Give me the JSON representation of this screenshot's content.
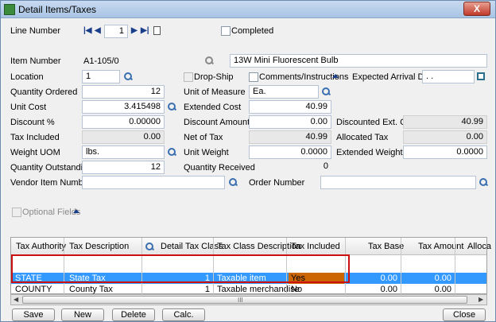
{
  "window": {
    "title": "Detail Items/Taxes",
    "close_label": "X"
  },
  "record": {
    "line_label": "Line Number",
    "line_value": "1",
    "completed_label": "Completed"
  },
  "item": {
    "label": "Item Number",
    "value": "A1-105/0",
    "description": "13W Mini Fluorescent Bulb"
  },
  "fields": {
    "location_label": "Location",
    "location_value": "1",
    "dropship_label": "Drop-Ship",
    "comments_label": "Comments/Instructions",
    "arrival_label": "Expected Arrival Date",
    "arrival_value": "  .  .",
    "qty_ordered_label": "Quantity Ordered",
    "qty_ordered_value": "12",
    "uom_label": "Unit of Measure",
    "uom_value": "Ea.",
    "unit_cost_label": "Unit Cost",
    "unit_cost_value": "3.415498",
    "ext_cost_label": "Extended Cost",
    "ext_cost_value": "40.99",
    "discount_pct_label": "Discount %",
    "discount_pct_value": "0.00000",
    "discount_amt_label": "Discount Amount",
    "discount_amt_value": "0.00",
    "disc_ext_cost_label": "Discounted Ext. Cost",
    "disc_ext_cost_value": "40.99",
    "tax_included_label": "Tax Included",
    "tax_included_value": "0.00",
    "net_of_tax_label": "Net of Tax",
    "net_of_tax_value": "40.99",
    "allocated_tax_label": "Allocated Tax",
    "allocated_tax_value": "0.00",
    "weight_uom_label": "Weight UOM",
    "weight_uom_value": "lbs.",
    "unit_weight_label": "Unit Weight",
    "unit_weight_value": "0.0000",
    "ext_weight_label": "Extended Weight",
    "ext_weight_value": "0.0000",
    "qty_outstanding_label": "Quantity Outstanding",
    "qty_outstanding_value": "12",
    "qty_received_label": "Quantity Received",
    "qty_received_value": "0",
    "vendor_item_label": "Vendor Item Number",
    "vendor_item_value": "",
    "order_number_label": "Order Number",
    "order_number_value": "",
    "optional_fields_label": "Optional Fields"
  },
  "grid": {
    "columns": [
      "Tax Authority",
      "Tax Description",
      "Detail Tax Class",
      "Tax Class Description",
      "Tax Included",
      "Tax Base",
      "Tax Amount",
      "Alloca"
    ],
    "rows": [
      [
        "STATE",
        "State Tax",
        "1",
        "Taxable item",
        "Yes",
        "0.00",
        "0.00"
      ],
      [
        "COUNTY",
        "County Tax",
        "1",
        "Taxable merchandise",
        "No",
        "0.00",
        "0.00"
      ]
    ],
    "scroll_grip": "III"
  },
  "buttons": {
    "save": "Save",
    "new": "New",
    "delete": "Delete",
    "calc_taxes": "Calc. Taxes",
    "close": "Close"
  },
  "colors": {
    "selection": "#3399ff",
    "highlight_cell": "#cc6600",
    "annotation_box": "#cc1010"
  }
}
